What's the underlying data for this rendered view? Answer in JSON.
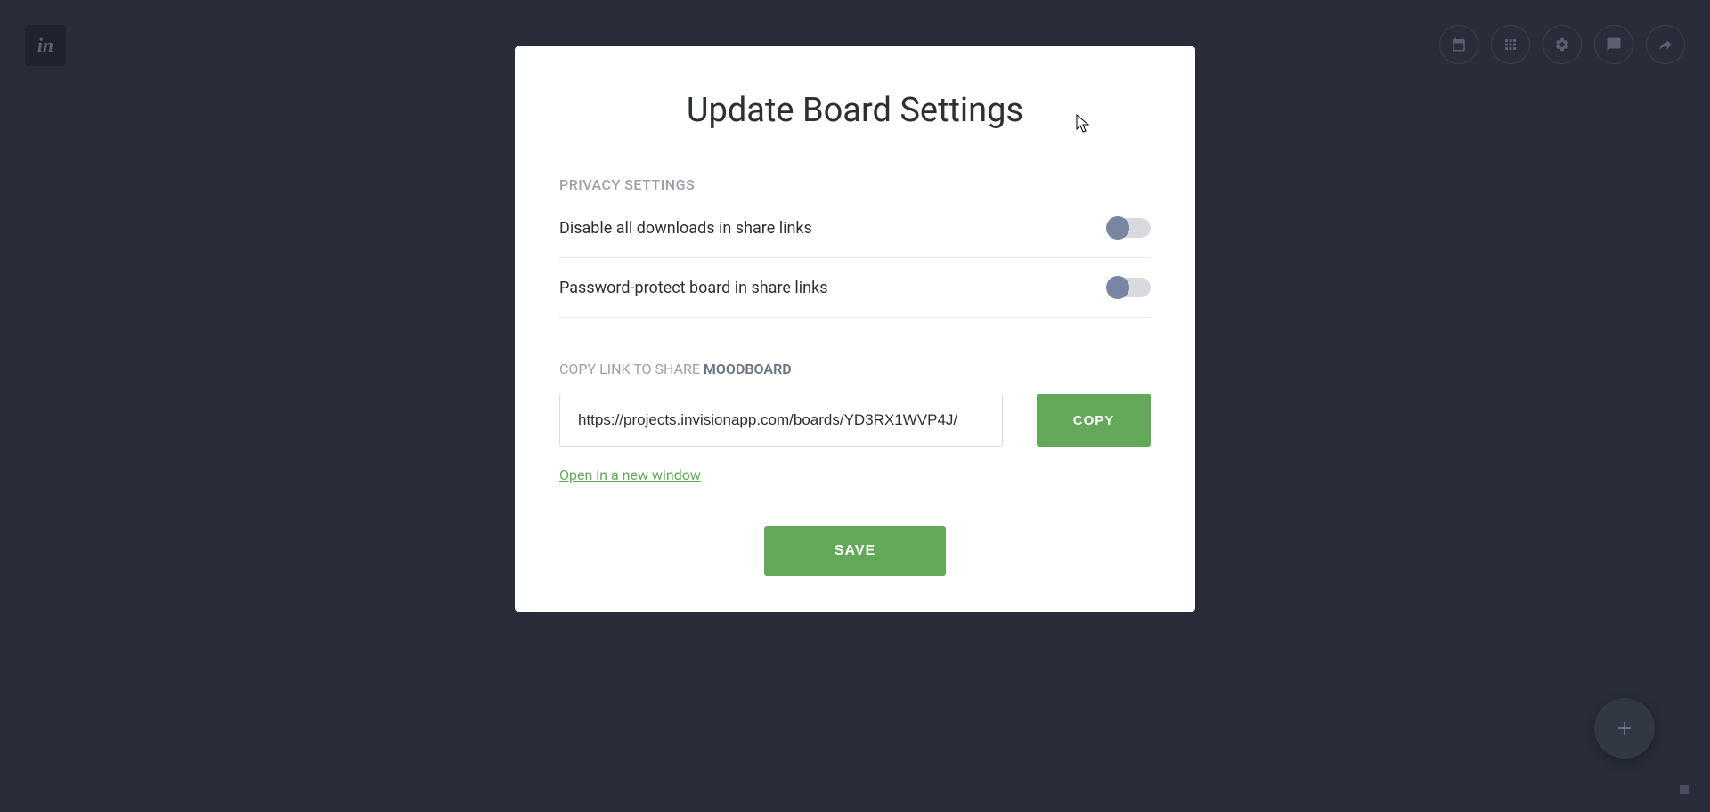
{
  "logo_text": "in",
  "modal": {
    "title": "Update Board Settings",
    "privacy_section_label": "PRIVACY SETTINGS",
    "settings": [
      {
        "label": "Disable all downloads in share links"
      },
      {
        "label": "Password-protect board in share links"
      }
    ],
    "share": {
      "label_prefix": "COPY LINK TO SHARE ",
      "label_bold": "MOODBOARD",
      "url": "https://projects.invisionapp.com/boards/YD3RX1WVP4J/",
      "copy_button": "COPY",
      "open_link": "Open in a new window"
    },
    "save_button": "SAVE"
  }
}
